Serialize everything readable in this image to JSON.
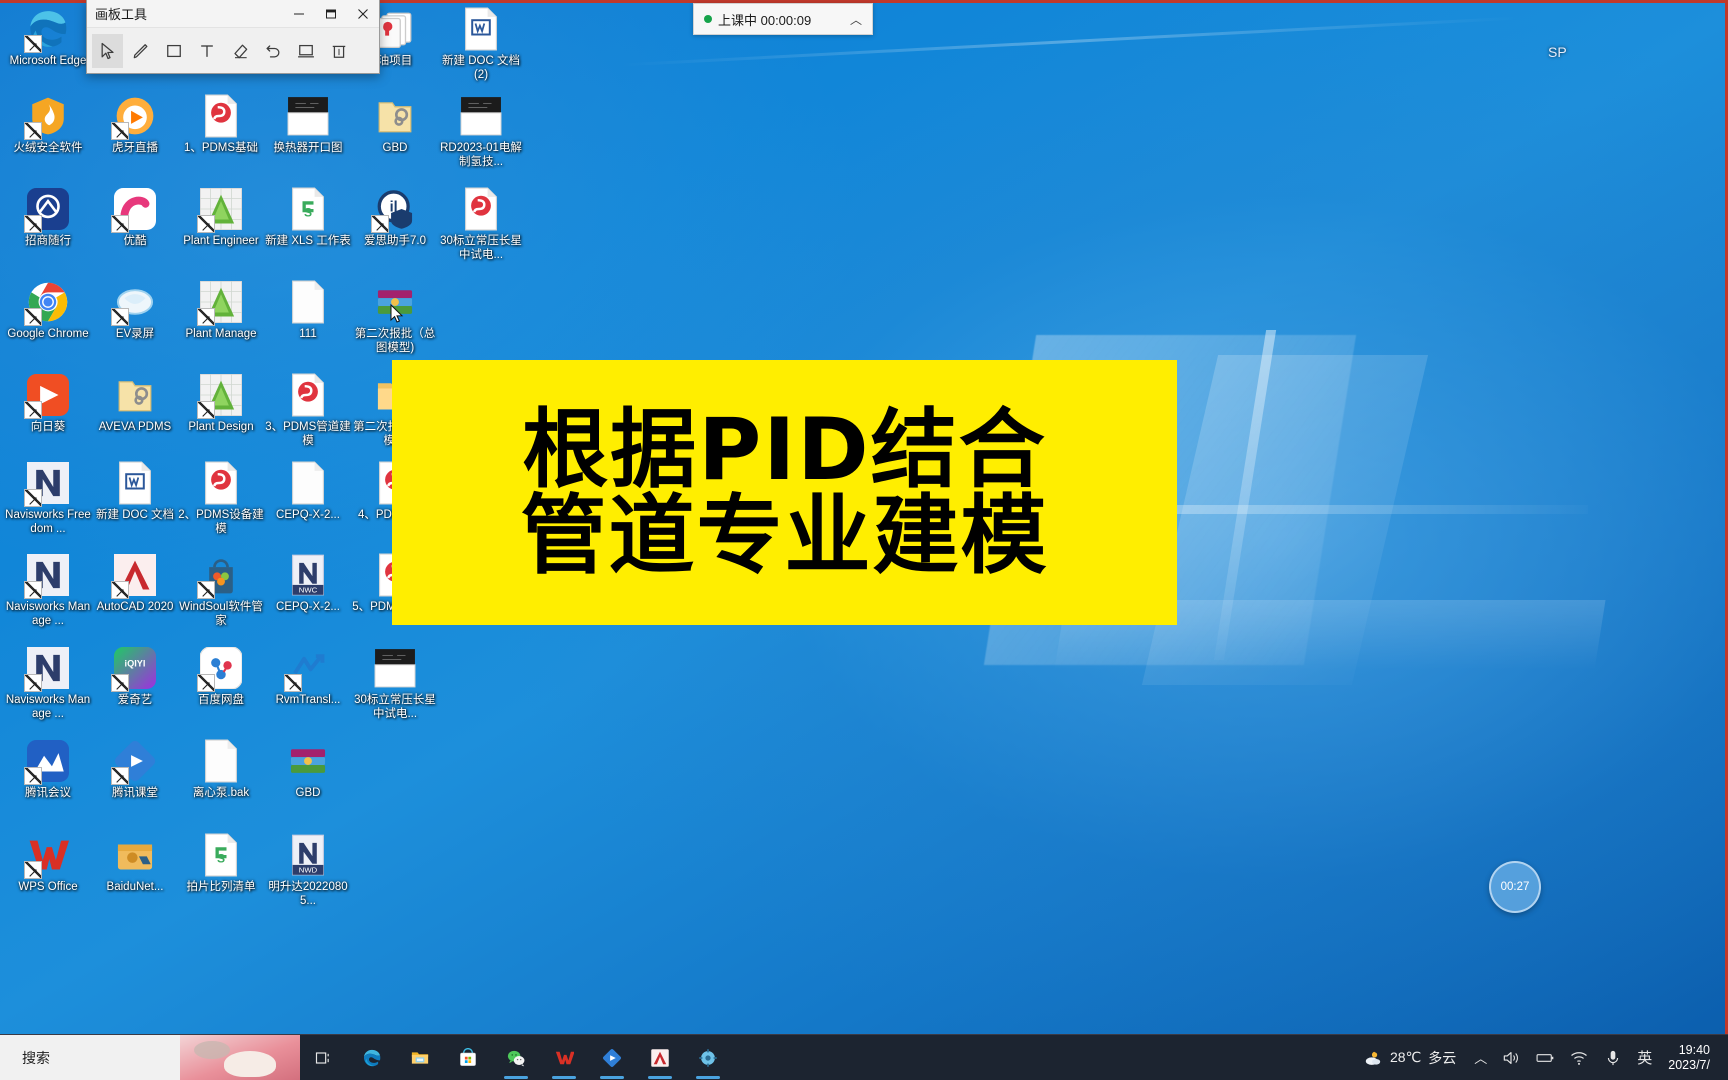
{
  "window": {
    "title": "画板工具",
    "buttons": {
      "minimize": "–",
      "maximize": "❐",
      "close": "✕"
    },
    "tools": [
      {
        "name": "select-tool",
        "icon": "cursor-arrow-icon",
        "active": true
      },
      {
        "name": "pencil-tool",
        "icon": "pencil-icon",
        "active": false
      },
      {
        "name": "rectangle-tool",
        "icon": "square-icon",
        "active": false
      },
      {
        "name": "text-tool",
        "icon": "text-t-icon",
        "active": false
      },
      {
        "name": "eraser-tool",
        "icon": "eraser-icon",
        "active": false
      },
      {
        "name": "undo-tool",
        "icon": "undo-arrow-icon",
        "active": false
      },
      {
        "name": "whiteboard-tool",
        "icon": "monitor-icon",
        "active": false
      },
      {
        "name": "clear-tool",
        "icon": "trash-icon",
        "active": false
      }
    ]
  },
  "recording": {
    "status_text": "上课中",
    "elapsed": "00:00:09",
    "label": "上课中 00:00:09",
    "chevron": "︿",
    "dot_color": "#16a34a",
    "border_color": "#c0392b"
  },
  "banner": {
    "line1": "根据PID结合",
    "line2": "管道专业建模",
    "background": "#ffee00",
    "text_color": "#000000"
  },
  "timer_bubble": {
    "value": "00:27"
  },
  "watermark": {
    "text": "SP"
  },
  "desktop": {
    "background_color": "#1186d8",
    "icons": [
      {
        "label": "Microsoft Edge",
        "icon": "edge-icon",
        "col": 0,
        "row": 0,
        "shortcut": true
      },
      {
        "label": "火绒安全软件",
        "icon": "huorong-shield-icon",
        "col": 0,
        "row": 1,
        "shortcut": true
      },
      {
        "label": "虎牙直播",
        "icon": "huya-icon",
        "col": 1,
        "row": 1,
        "shortcut": true
      },
      {
        "label": "1、PDMS基础",
        "icon": "pdf-doc-icon",
        "col": 2,
        "row": 1,
        "shortcut": false
      },
      {
        "label": "换热器开口图",
        "icon": "dwg-thumb-icon",
        "col": 3,
        "row": 1,
        "shortcut": false
      },
      {
        "label": "GBD",
        "icon": "folder-gear-icon",
        "col": 4,
        "row": 1,
        "shortcut": false
      },
      {
        "label": "RD2023-01电解制氢技...",
        "icon": "dwg-thumb-icon",
        "col": 5,
        "row": 1,
        "shortcut": false
      },
      {
        "label": "招商随行",
        "icon": "cmb-icon",
        "col": 0,
        "row": 2,
        "shortcut": true
      },
      {
        "label": "优酷",
        "icon": "youku-icon",
        "col": 1,
        "row": 2,
        "shortcut": true
      },
      {
        "label": "Plant Engineer",
        "icon": "plant-engineer-icon",
        "col": 2,
        "row": 2,
        "shortcut": true
      },
      {
        "label": "新建 XLS 工作表",
        "icon": "xls-doc-icon",
        "col": 3,
        "row": 2,
        "shortcut": false
      },
      {
        "label": "爱思助手7.0",
        "icon": "aisi-icon",
        "col": 4,
        "row": 2,
        "shortcut": true
      },
      {
        "label": "30标立常压长星中试电...",
        "icon": "pdf-doc-icon",
        "col": 5,
        "row": 2,
        "shortcut": false
      },
      {
        "label": "Google Chrome",
        "icon": "chrome-icon",
        "col": 0,
        "row": 3,
        "shortcut": true
      },
      {
        "label": "EV录屏",
        "icon": "ev-recorder-icon",
        "col": 1,
        "row": 3,
        "shortcut": true
      },
      {
        "label": "Plant Manage",
        "icon": "plant-manage-icon",
        "col": 2,
        "row": 3,
        "shortcut": true
      },
      {
        "label": "111",
        "icon": "blank-doc-icon",
        "col": 3,
        "row": 3,
        "shortcut": false
      },
      {
        "label": "第二次报批（总图模型)",
        "icon": "winrar-icon",
        "col": 4,
        "row": 3,
        "shortcut": false
      },
      {
        "label": "向日葵",
        "icon": "sunlogin-icon",
        "col": 0,
        "row": 4,
        "shortcut": true
      },
      {
        "label": "AVEVA PDMS",
        "icon": "folder-gear-icon",
        "col": 1,
        "row": 4,
        "shortcut": false
      },
      {
        "label": "Plant Design",
        "icon": "plant-design-icon",
        "col": 2,
        "row": 4,
        "shortcut": true
      },
      {
        "label": "3、PDMS管道建模",
        "icon": "pdf-doc-icon",
        "col": 3,
        "row": 4,
        "shortcut": false
      },
      {
        "label": "第二次报批 总图模型",
        "icon": "folder-icon",
        "col": 4,
        "row": 4,
        "shortcut": false
      },
      {
        "label": "Navisworks Freedom ...",
        "icon": "navisworks-icon",
        "col": 0,
        "row": 5,
        "shortcut": true
      },
      {
        "label": "新建 DOC 文档",
        "icon": "word-doc-icon",
        "col": 1,
        "row": 5,
        "shortcut": false
      },
      {
        "label": "2、PDMS设备建模",
        "icon": "pdf-doc-icon",
        "col": 2,
        "row": 5,
        "shortcut": false
      },
      {
        "label": "CEPQ-X-2...",
        "icon": "blank-doc-icon",
        "col": 3,
        "row": 5,
        "shortcut": false
      },
      {
        "label": "4、PDMS构建",
        "icon": "pdf-doc-icon",
        "col": 4,
        "row": 5,
        "shortcut": false
      },
      {
        "label": "Navisworks Manage ...",
        "icon": "navisworks-icon",
        "col": 0,
        "row": 6,
        "shortcut": true
      },
      {
        "label": "AutoCAD 2020",
        "icon": "autocad-icon",
        "col": 1,
        "row": 6,
        "shortcut": true
      },
      {
        "label": "WindSoul软件管家",
        "icon": "windsoul-icon",
        "col": 2,
        "row": 6,
        "shortcut": true
      },
      {
        "label": "CEPQ-X-2...",
        "icon": "nwc-icon",
        "col": 3,
        "row": 6,
        "shortcut": false
      },
      {
        "label": "5、PDMS缆桥架",
        "icon": "pdf-doc-icon",
        "col": 4,
        "row": 6,
        "shortcut": false
      },
      {
        "label": "Navisworks Manage ...",
        "icon": "navisworks-icon",
        "col": 0,
        "row": 7,
        "shortcut": true
      },
      {
        "label": "爱奇艺",
        "icon": "iqiyi-icon",
        "col": 1,
        "row": 7,
        "shortcut": true
      },
      {
        "label": "百度网盘",
        "icon": "baidu-netdisk-icon",
        "col": 2,
        "row": 7,
        "shortcut": true
      },
      {
        "label": "RvmTransl...",
        "icon": "rvm-translator-icon",
        "col": 3,
        "row": 7,
        "shortcut": true
      },
      {
        "label": "30标立常压长星中试电...",
        "icon": "dwg-thumb-icon",
        "col": 4,
        "row": 7,
        "shortcut": false
      },
      {
        "label": "腾讯会议",
        "icon": "tencent-meeting-icon",
        "col": 0,
        "row": 8,
        "shortcut": true
      },
      {
        "label": "腾讯课堂",
        "icon": "tencent-classroom-icon",
        "col": 1,
        "row": 8,
        "shortcut": true
      },
      {
        "label": "离心泵.bak",
        "icon": "blank-doc-icon",
        "col": 2,
        "row": 8,
        "shortcut": false
      },
      {
        "label": "GBD",
        "icon": "winrar-icon",
        "col": 3,
        "row": 8,
        "shortcut": false
      },
      {
        "label": "WPS Office",
        "icon": "wps-icon",
        "col": 0,
        "row": 9,
        "shortcut": true
      },
      {
        "label": "BaiduNet...",
        "icon": "baidu-netdisk-box-icon",
        "col": 1,
        "row": 9,
        "shortcut": false
      },
      {
        "label": "拍片比列清单",
        "icon": "xls-doc-icon",
        "col": 2,
        "row": 9,
        "shortcut": false
      },
      {
        "label": "明升达20220805...",
        "icon": "nwd-icon",
        "col": 3,
        "row": 9,
        "shortcut": false
      },
      {
        "label": "油项目",
        "icon": "folder-stack-icon",
        "col": 4,
        "row": 0,
        "shortcut": false
      },
      {
        "label": "新建 DOC 文档 (2)",
        "icon": "word-doc-icon",
        "col": 5,
        "row": 0,
        "shortcut": false
      }
    ]
  },
  "taskbar": {
    "search_placeholder": "搜索",
    "buttons": [
      {
        "name": "task-view-button",
        "icon": "task-view-icon"
      },
      {
        "name": "edge-taskbar-button",
        "icon": "edge-icon"
      },
      {
        "name": "explorer-taskbar-button",
        "icon": "folder-icon"
      },
      {
        "name": "store-taskbar-button",
        "icon": "microsoft-store-icon"
      },
      {
        "name": "wechat-taskbar-button",
        "icon": "wechat-icon",
        "running": true
      },
      {
        "name": "wps-taskbar-button",
        "icon": "wps-icon",
        "running": true
      },
      {
        "name": "evcapture-taskbar-button",
        "icon": "ev-recorder-icon",
        "running": true
      },
      {
        "name": "autocad-taskbar-button",
        "icon": "autocad-icon",
        "running": true
      },
      {
        "name": "settings-taskbar-button",
        "icon": "gear-icon",
        "running": true
      }
    ],
    "tray": {
      "weather_temp": "28℃",
      "weather_desc": "多云",
      "weather_icon": "partly-cloudy-icon",
      "chevron": "︿",
      "icons": [
        {
          "name": "volume-tray-icon",
          "icon": "speaker-icon"
        },
        {
          "name": "battery-tray-icon",
          "icon": "battery-icon"
        },
        {
          "name": "network-tray-icon",
          "icon": "wifi-icon"
        },
        {
          "name": "microphone-tray-icon",
          "icon": "microphone-icon"
        }
      ],
      "ime": "英",
      "time": "19:40",
      "date": "2023/7/"
    }
  }
}
